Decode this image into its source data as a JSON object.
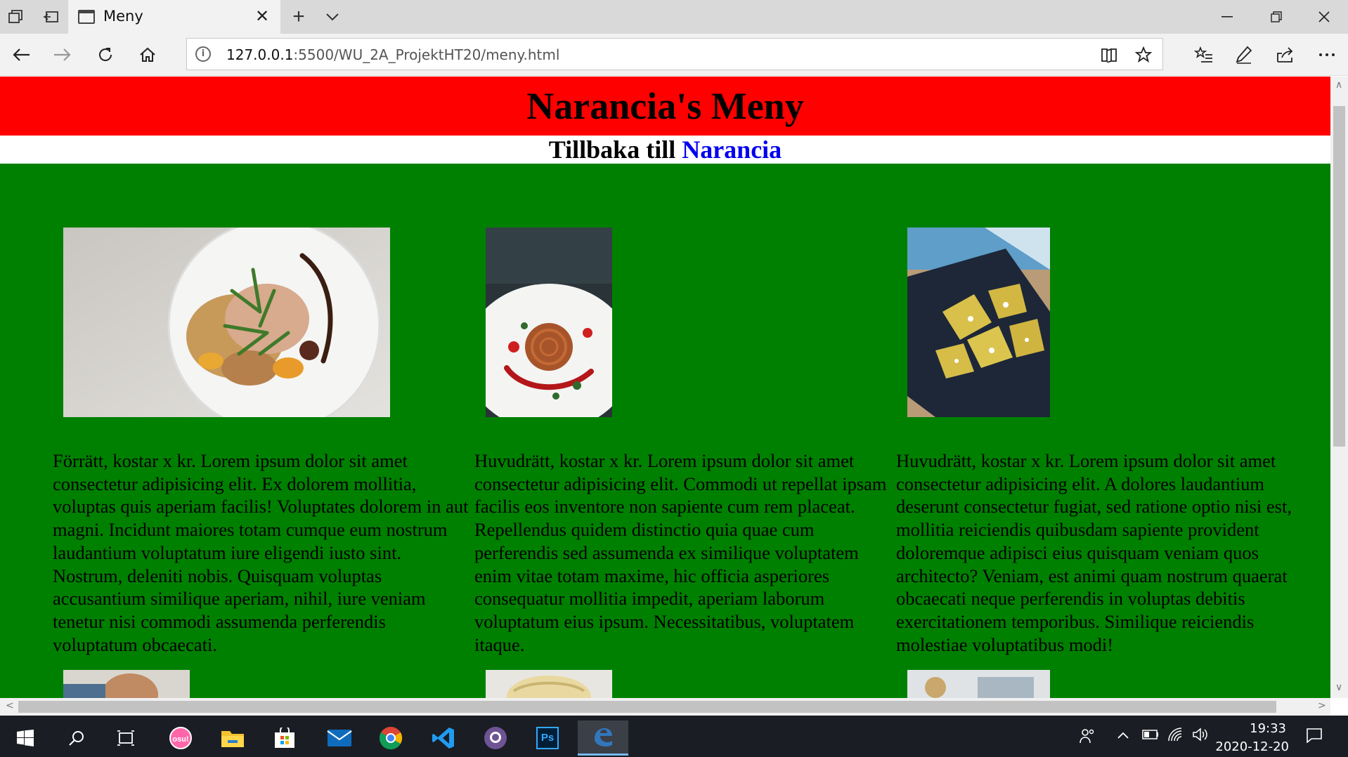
{
  "browser": {
    "tab_title": "Meny",
    "url_host": "127.0.0.1",
    "url_path": ":5500/WU_2A_ProjektHT20/meny.html"
  },
  "page": {
    "title": "Narancia's Meny",
    "back_prefix": "Tillbaka till",
    "back_link": "Narancia",
    "dishes": [
      {
        "description": "Förrätt, kostar x kr. Lorem ipsum dolor sit amet consectetur adipisicing elit. Ex dolorem mollitia, voluptas quis aperiam facilis! Voluptates dolorem in aut magni. Incidunt maiores totam cumque eum nostrum laudantium voluptatum iure eligendi iusto sint. Nostrum, deleniti nobis. Quisquam voluptas accusantium similique aperiam, nihil, iure veniam tenetur nisi commodi assumenda perferendis voluptatum obcaecati."
      },
      {
        "description": "Huvudrätt, kostar x kr. Lorem ipsum dolor sit amet consectetur adipisicing elit. Commodi ut repellat ipsam facilis eos inventore non sapiente cum rem placeat. Repellendus quidem distinctio quia quae cum perferendis sed assumenda ex similique voluptatem enim vitae totam maxime, hic officia asperiores consequatur mollitia impedit, aperiam laborum voluptatum eius ipsum. Necessitatibus, voluptatem itaque."
      },
      {
        "description": "Huvudrätt, kostar x kr. Lorem ipsum dolor sit amet consectetur adipisicing elit. A dolores laudantium deserunt consectetur fugiat, sed ratione optio nisi est, mollitia reiciendis quibusdam sapiente provident doloremque adipisci eius quisquam veniam quos architecto? Veniam, est animi quam nostrum quaerat obcaecati neque perferendis in voluptas debitis exercitationem temporibus. Similique reiciendis molestiae voluptatibus modi!"
      }
    ]
  },
  "taskbar": {
    "time": "19:33",
    "date": "2020-12-20",
    "apps": [
      "start",
      "search",
      "task-view",
      "osu",
      "file-explorer",
      "store",
      "mail",
      "chrome",
      "vscode",
      "github",
      "photoshop",
      "edge"
    ]
  },
  "colors": {
    "header_bg": "#ff0000",
    "page_bg": "#008000",
    "link": "#0000ee"
  }
}
